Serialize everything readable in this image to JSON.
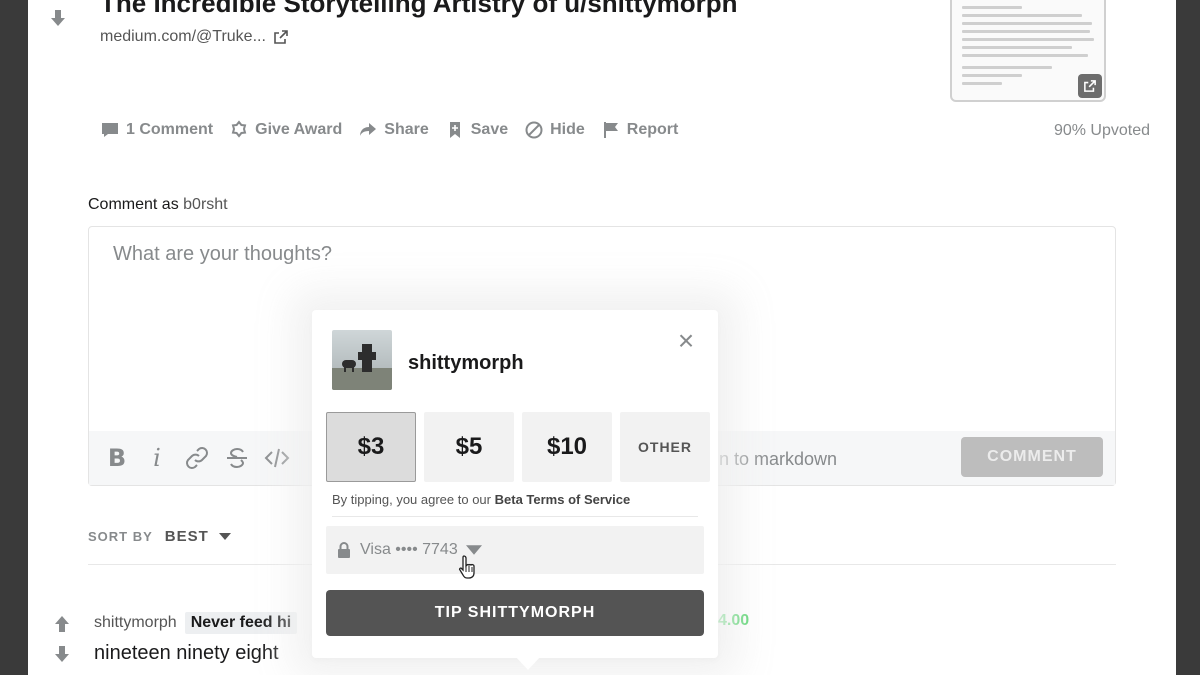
{
  "post": {
    "title": "The Incredible Storytelling Artistry of u/shittymorph",
    "link_text": "medium.com/@Truke...",
    "upvoted": "90% Upvoted"
  },
  "actions": [
    {
      "label": "1 Comment",
      "icon": "comment-icon"
    },
    {
      "label": "Give Award",
      "icon": "award-icon"
    },
    {
      "label": "Share",
      "icon": "share-icon"
    },
    {
      "label": "Save",
      "icon": "bookmark-icon"
    },
    {
      "label": "Hide",
      "icon": "hide-icon"
    },
    {
      "label": "Report",
      "icon": "flag-icon"
    }
  ],
  "comment_form": {
    "comment_as_label": "Comment as",
    "username": "b0rsht",
    "placeholder": "What are your thoughts?",
    "markdown_text": "n to markdown",
    "submit_label": "COMMENT",
    "toolbar_icons": [
      "bold-icon",
      "italic-icon",
      "link-icon",
      "strikethrough-icon",
      "code-icon"
    ]
  },
  "sort": {
    "label": "SORT BY",
    "value": "BEST"
  },
  "comment": {
    "author": "shittymorph",
    "flair": "Never feed hi",
    "coins": "4.00",
    "text": "nineteen ninety eight"
  },
  "tip_modal": {
    "username": "shittymorph",
    "amounts": [
      "$3",
      "$5",
      "$10",
      "OTHER"
    ],
    "selected_amount": "$3",
    "terms_prefix": "By tipping, you agree to our",
    "terms_link": "Beta Terms of Service",
    "payment_method": "Visa •••• 7743",
    "tip_button": "TIP SHITTYMORPH"
  },
  "colors": {
    "coins_green": "#46d160",
    "tip_button": "#545454",
    "muted": "#878a8c"
  }
}
